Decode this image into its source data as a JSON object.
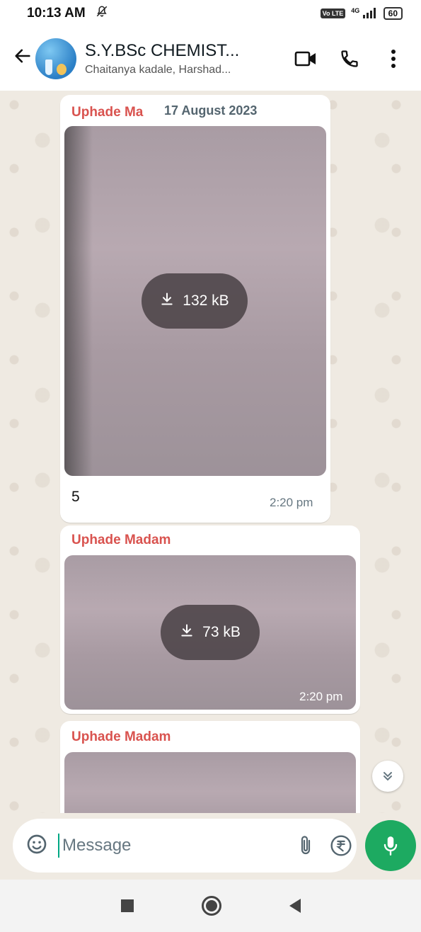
{
  "status_bar": {
    "time": "10:13 AM",
    "network_label": "4G",
    "volte_label": "Vo LTE",
    "battery": "60"
  },
  "header": {
    "title": "S.Y.BSc CHEMIST...",
    "subtitle": "Chaitanya kadale, Harshad..."
  },
  "chat": {
    "date_chip": "17 August 2023",
    "messages": [
      {
        "sender": "Uphade Ma",
        "download_size": "132 kB",
        "caption": "5",
        "time": "2:20 pm"
      },
      {
        "sender": "Uphade Madam",
        "download_size": "73 kB",
        "time": "2:20 pm"
      },
      {
        "sender": "Uphade Madam"
      }
    ]
  },
  "input": {
    "placeholder": "Message"
  },
  "colors": {
    "sender": "#d9534f",
    "accent_green": "#1daa61",
    "chat_bg": "#efeae2"
  }
}
